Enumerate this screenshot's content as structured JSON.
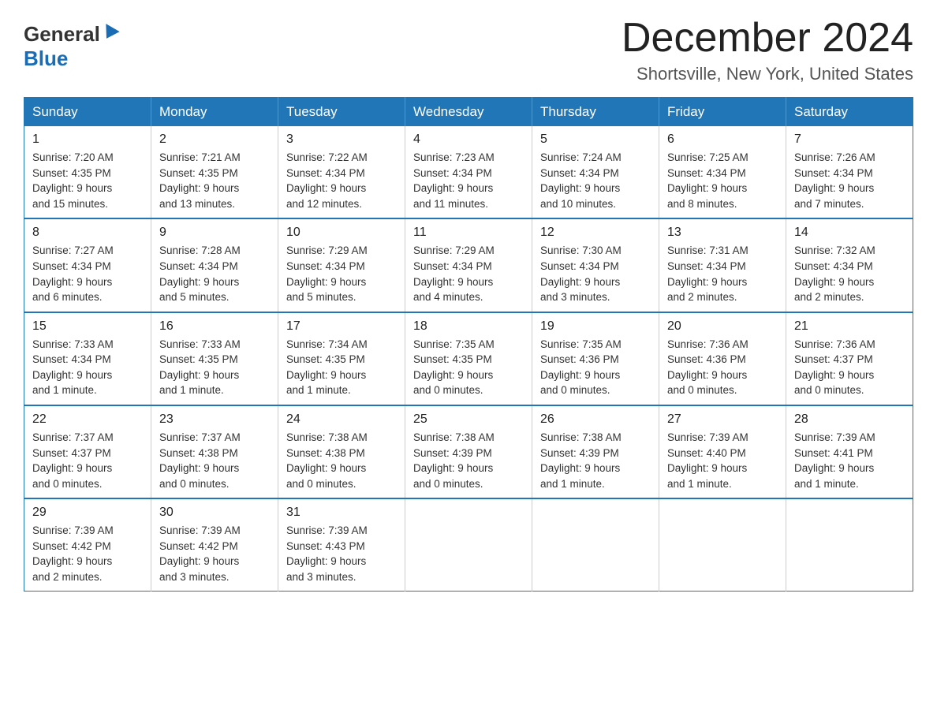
{
  "logo": {
    "general": "General",
    "blue": "Blue"
  },
  "title": "December 2024",
  "location": "Shortsville, New York, United States",
  "days_of_week": [
    "Sunday",
    "Monday",
    "Tuesday",
    "Wednesday",
    "Thursday",
    "Friday",
    "Saturday"
  ],
  "weeks": [
    [
      {
        "day": "1",
        "sunrise": "7:20 AM",
        "sunset": "4:35 PM",
        "daylight": "9 hours and 15 minutes."
      },
      {
        "day": "2",
        "sunrise": "7:21 AM",
        "sunset": "4:35 PM",
        "daylight": "9 hours and 13 minutes."
      },
      {
        "day": "3",
        "sunrise": "7:22 AM",
        "sunset": "4:34 PM",
        "daylight": "9 hours and 12 minutes."
      },
      {
        "day": "4",
        "sunrise": "7:23 AM",
        "sunset": "4:34 PM",
        "daylight": "9 hours and 11 minutes."
      },
      {
        "day": "5",
        "sunrise": "7:24 AM",
        "sunset": "4:34 PM",
        "daylight": "9 hours and 10 minutes."
      },
      {
        "day": "6",
        "sunrise": "7:25 AM",
        "sunset": "4:34 PM",
        "daylight": "9 hours and 8 minutes."
      },
      {
        "day": "7",
        "sunrise": "7:26 AM",
        "sunset": "4:34 PM",
        "daylight": "9 hours and 7 minutes."
      }
    ],
    [
      {
        "day": "8",
        "sunrise": "7:27 AM",
        "sunset": "4:34 PM",
        "daylight": "9 hours and 6 minutes."
      },
      {
        "day": "9",
        "sunrise": "7:28 AM",
        "sunset": "4:34 PM",
        "daylight": "9 hours and 5 minutes."
      },
      {
        "day": "10",
        "sunrise": "7:29 AM",
        "sunset": "4:34 PM",
        "daylight": "9 hours and 5 minutes."
      },
      {
        "day": "11",
        "sunrise": "7:29 AM",
        "sunset": "4:34 PM",
        "daylight": "9 hours and 4 minutes."
      },
      {
        "day": "12",
        "sunrise": "7:30 AM",
        "sunset": "4:34 PM",
        "daylight": "9 hours and 3 minutes."
      },
      {
        "day": "13",
        "sunrise": "7:31 AM",
        "sunset": "4:34 PM",
        "daylight": "9 hours and 2 minutes."
      },
      {
        "day": "14",
        "sunrise": "7:32 AM",
        "sunset": "4:34 PM",
        "daylight": "9 hours and 2 minutes."
      }
    ],
    [
      {
        "day": "15",
        "sunrise": "7:33 AM",
        "sunset": "4:34 PM",
        "daylight": "9 hours and 1 minute."
      },
      {
        "day": "16",
        "sunrise": "7:33 AM",
        "sunset": "4:35 PM",
        "daylight": "9 hours and 1 minute."
      },
      {
        "day": "17",
        "sunrise": "7:34 AM",
        "sunset": "4:35 PM",
        "daylight": "9 hours and 1 minute."
      },
      {
        "day": "18",
        "sunrise": "7:35 AM",
        "sunset": "4:35 PM",
        "daylight": "9 hours and 0 minutes."
      },
      {
        "day": "19",
        "sunrise": "7:35 AM",
        "sunset": "4:36 PM",
        "daylight": "9 hours and 0 minutes."
      },
      {
        "day": "20",
        "sunrise": "7:36 AM",
        "sunset": "4:36 PM",
        "daylight": "9 hours and 0 minutes."
      },
      {
        "day": "21",
        "sunrise": "7:36 AM",
        "sunset": "4:37 PM",
        "daylight": "9 hours and 0 minutes."
      }
    ],
    [
      {
        "day": "22",
        "sunrise": "7:37 AM",
        "sunset": "4:37 PM",
        "daylight": "9 hours and 0 minutes."
      },
      {
        "day": "23",
        "sunrise": "7:37 AM",
        "sunset": "4:38 PM",
        "daylight": "9 hours and 0 minutes."
      },
      {
        "day": "24",
        "sunrise": "7:38 AM",
        "sunset": "4:38 PM",
        "daylight": "9 hours and 0 minutes."
      },
      {
        "day": "25",
        "sunrise": "7:38 AM",
        "sunset": "4:39 PM",
        "daylight": "9 hours and 0 minutes."
      },
      {
        "day": "26",
        "sunrise": "7:38 AM",
        "sunset": "4:39 PM",
        "daylight": "9 hours and 1 minute."
      },
      {
        "day": "27",
        "sunrise": "7:39 AM",
        "sunset": "4:40 PM",
        "daylight": "9 hours and 1 minute."
      },
      {
        "day": "28",
        "sunrise": "7:39 AM",
        "sunset": "4:41 PM",
        "daylight": "9 hours and 1 minute."
      }
    ],
    [
      {
        "day": "29",
        "sunrise": "7:39 AM",
        "sunset": "4:42 PM",
        "daylight": "9 hours and 2 minutes."
      },
      {
        "day": "30",
        "sunrise": "7:39 AM",
        "sunset": "4:42 PM",
        "daylight": "9 hours and 3 minutes."
      },
      {
        "day": "31",
        "sunrise": "7:39 AM",
        "sunset": "4:43 PM",
        "daylight": "9 hours and 3 minutes."
      },
      null,
      null,
      null,
      null
    ]
  ],
  "labels": {
    "sunrise": "Sunrise:",
    "sunset": "Sunset:",
    "daylight": "Daylight:"
  }
}
